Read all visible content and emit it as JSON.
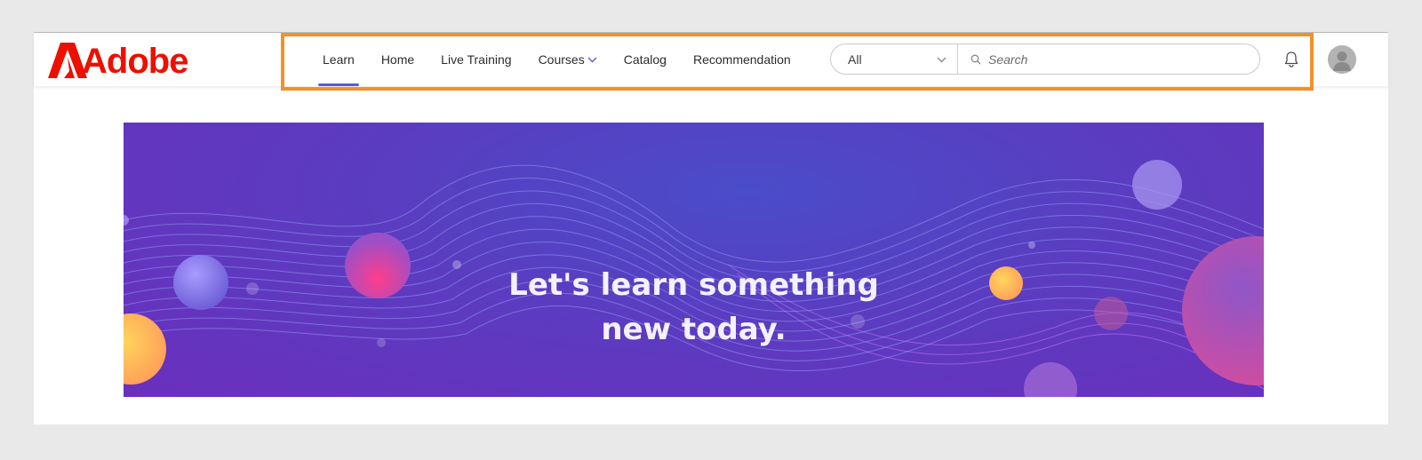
{
  "brand": {
    "logo_text": "Adobe",
    "color": "#eb1000"
  },
  "nav": {
    "items": [
      {
        "label": "Learn",
        "active": true
      },
      {
        "label": "Home",
        "active": false
      },
      {
        "label": "Live Training",
        "active": false
      },
      {
        "label": "Courses",
        "active": false,
        "has_dropdown": true
      },
      {
        "label": "Catalog",
        "active": false
      },
      {
        "label": "Recommendation",
        "active": false
      }
    ],
    "active_color": "#5b5bd6"
  },
  "search": {
    "filter_value": "All",
    "placeholder": "Search"
  },
  "icons": {
    "bell": "bell-icon",
    "avatar": "user-avatar",
    "search": "search-icon",
    "chevron": "chevron-down-icon"
  },
  "highlight": {
    "color": "#f0922b"
  },
  "banner": {
    "headline_line1": "Let's learn something",
    "headline_line2": "new today."
  }
}
